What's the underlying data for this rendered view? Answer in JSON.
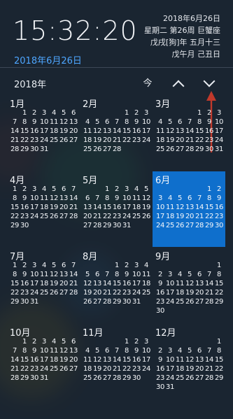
{
  "header": {
    "time": "15:32:20",
    "date_link": "2018年6月26日"
  },
  "lunar": {
    "line1": "2018年6月26日",
    "line2": "星期二 第26周 巨蟹座",
    "line3": "戊戌[狗]年 五月十三",
    "line4": "戊午月 己丑日"
  },
  "nav": {
    "year": "2018年",
    "today_label": "今",
    "up_icon": "chevron-up-icon",
    "down_icon": "chevron-down-icon"
  },
  "colors": {
    "selected_month": "#0f6fcc",
    "link": "#4ea6ff",
    "annotation_arrow": "#c0392b"
  },
  "months": [
    {
      "name": "1月",
      "offset": 1,
      "days": 31
    },
    {
      "name": "2月",
      "offset": 4,
      "days": 28
    },
    {
      "name": "3月",
      "offset": 4,
      "days": 31
    },
    {
      "name": "4月",
      "offset": 0,
      "days": 30
    },
    {
      "name": "5月",
      "offset": 2,
      "days": 31
    },
    {
      "name": "6月",
      "offset": 5,
      "days": 30,
      "selected": true
    },
    {
      "name": "7月",
      "offset": 0,
      "days": 31
    },
    {
      "name": "8月",
      "offset": 3,
      "days": 31
    },
    {
      "name": "9月",
      "offset": 6,
      "days": 30
    },
    {
      "name": "10月",
      "offset": 1,
      "days": 31
    },
    {
      "name": "11月",
      "offset": 4,
      "days": 30
    },
    {
      "name": "12月",
      "offset": 6,
      "days": 31
    }
  ]
}
